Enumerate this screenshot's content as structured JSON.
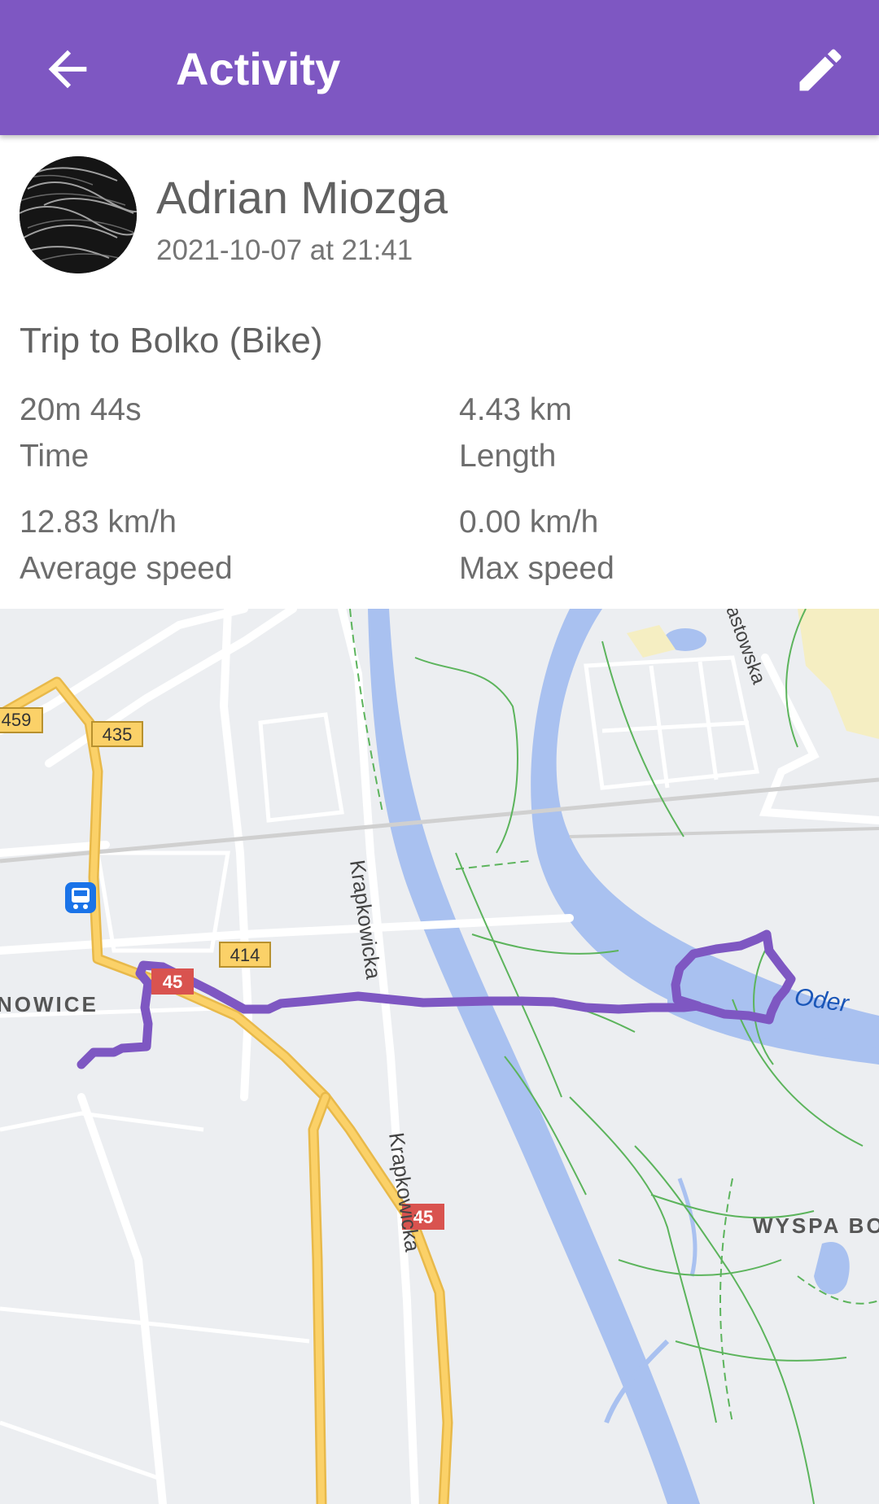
{
  "appbar": {
    "title": "Activity",
    "back_icon": "arrow-back-icon",
    "edit_icon": "pencil-edit-icon",
    "color": "#7e57c2"
  },
  "profile": {
    "name": "Adrian Miozga",
    "datetime": "2021-10-07 at 21:41"
  },
  "activity": {
    "title": "Trip to Bolko (Bike)",
    "stats": {
      "time": {
        "value": "20m 44s",
        "label": "Time"
      },
      "length": {
        "value": "4.43 km",
        "label": "Length"
      },
      "avg_speed": {
        "value": "12.83 km/h",
        "label": "Average speed"
      },
      "max_speed": {
        "value": "0.00 km/h",
        "label": "Max speed"
      }
    }
  },
  "map": {
    "route_color": "#7e57c2",
    "road_labels": {
      "r459": "459",
      "r435": "435",
      "r414": "414",
      "r45a": "45",
      "r45b": "45"
    },
    "street_labels": {
      "krapkowicka_1": "Krapkowicka",
      "krapkowicka_2": "Krapkowicka",
      "piastowska": "astowska",
      "oder": "Oder",
      "wyspa": "WYSPA BO",
      "nowice": "NOWICE"
    },
    "transit_icon": "bus-stop-icon"
  }
}
